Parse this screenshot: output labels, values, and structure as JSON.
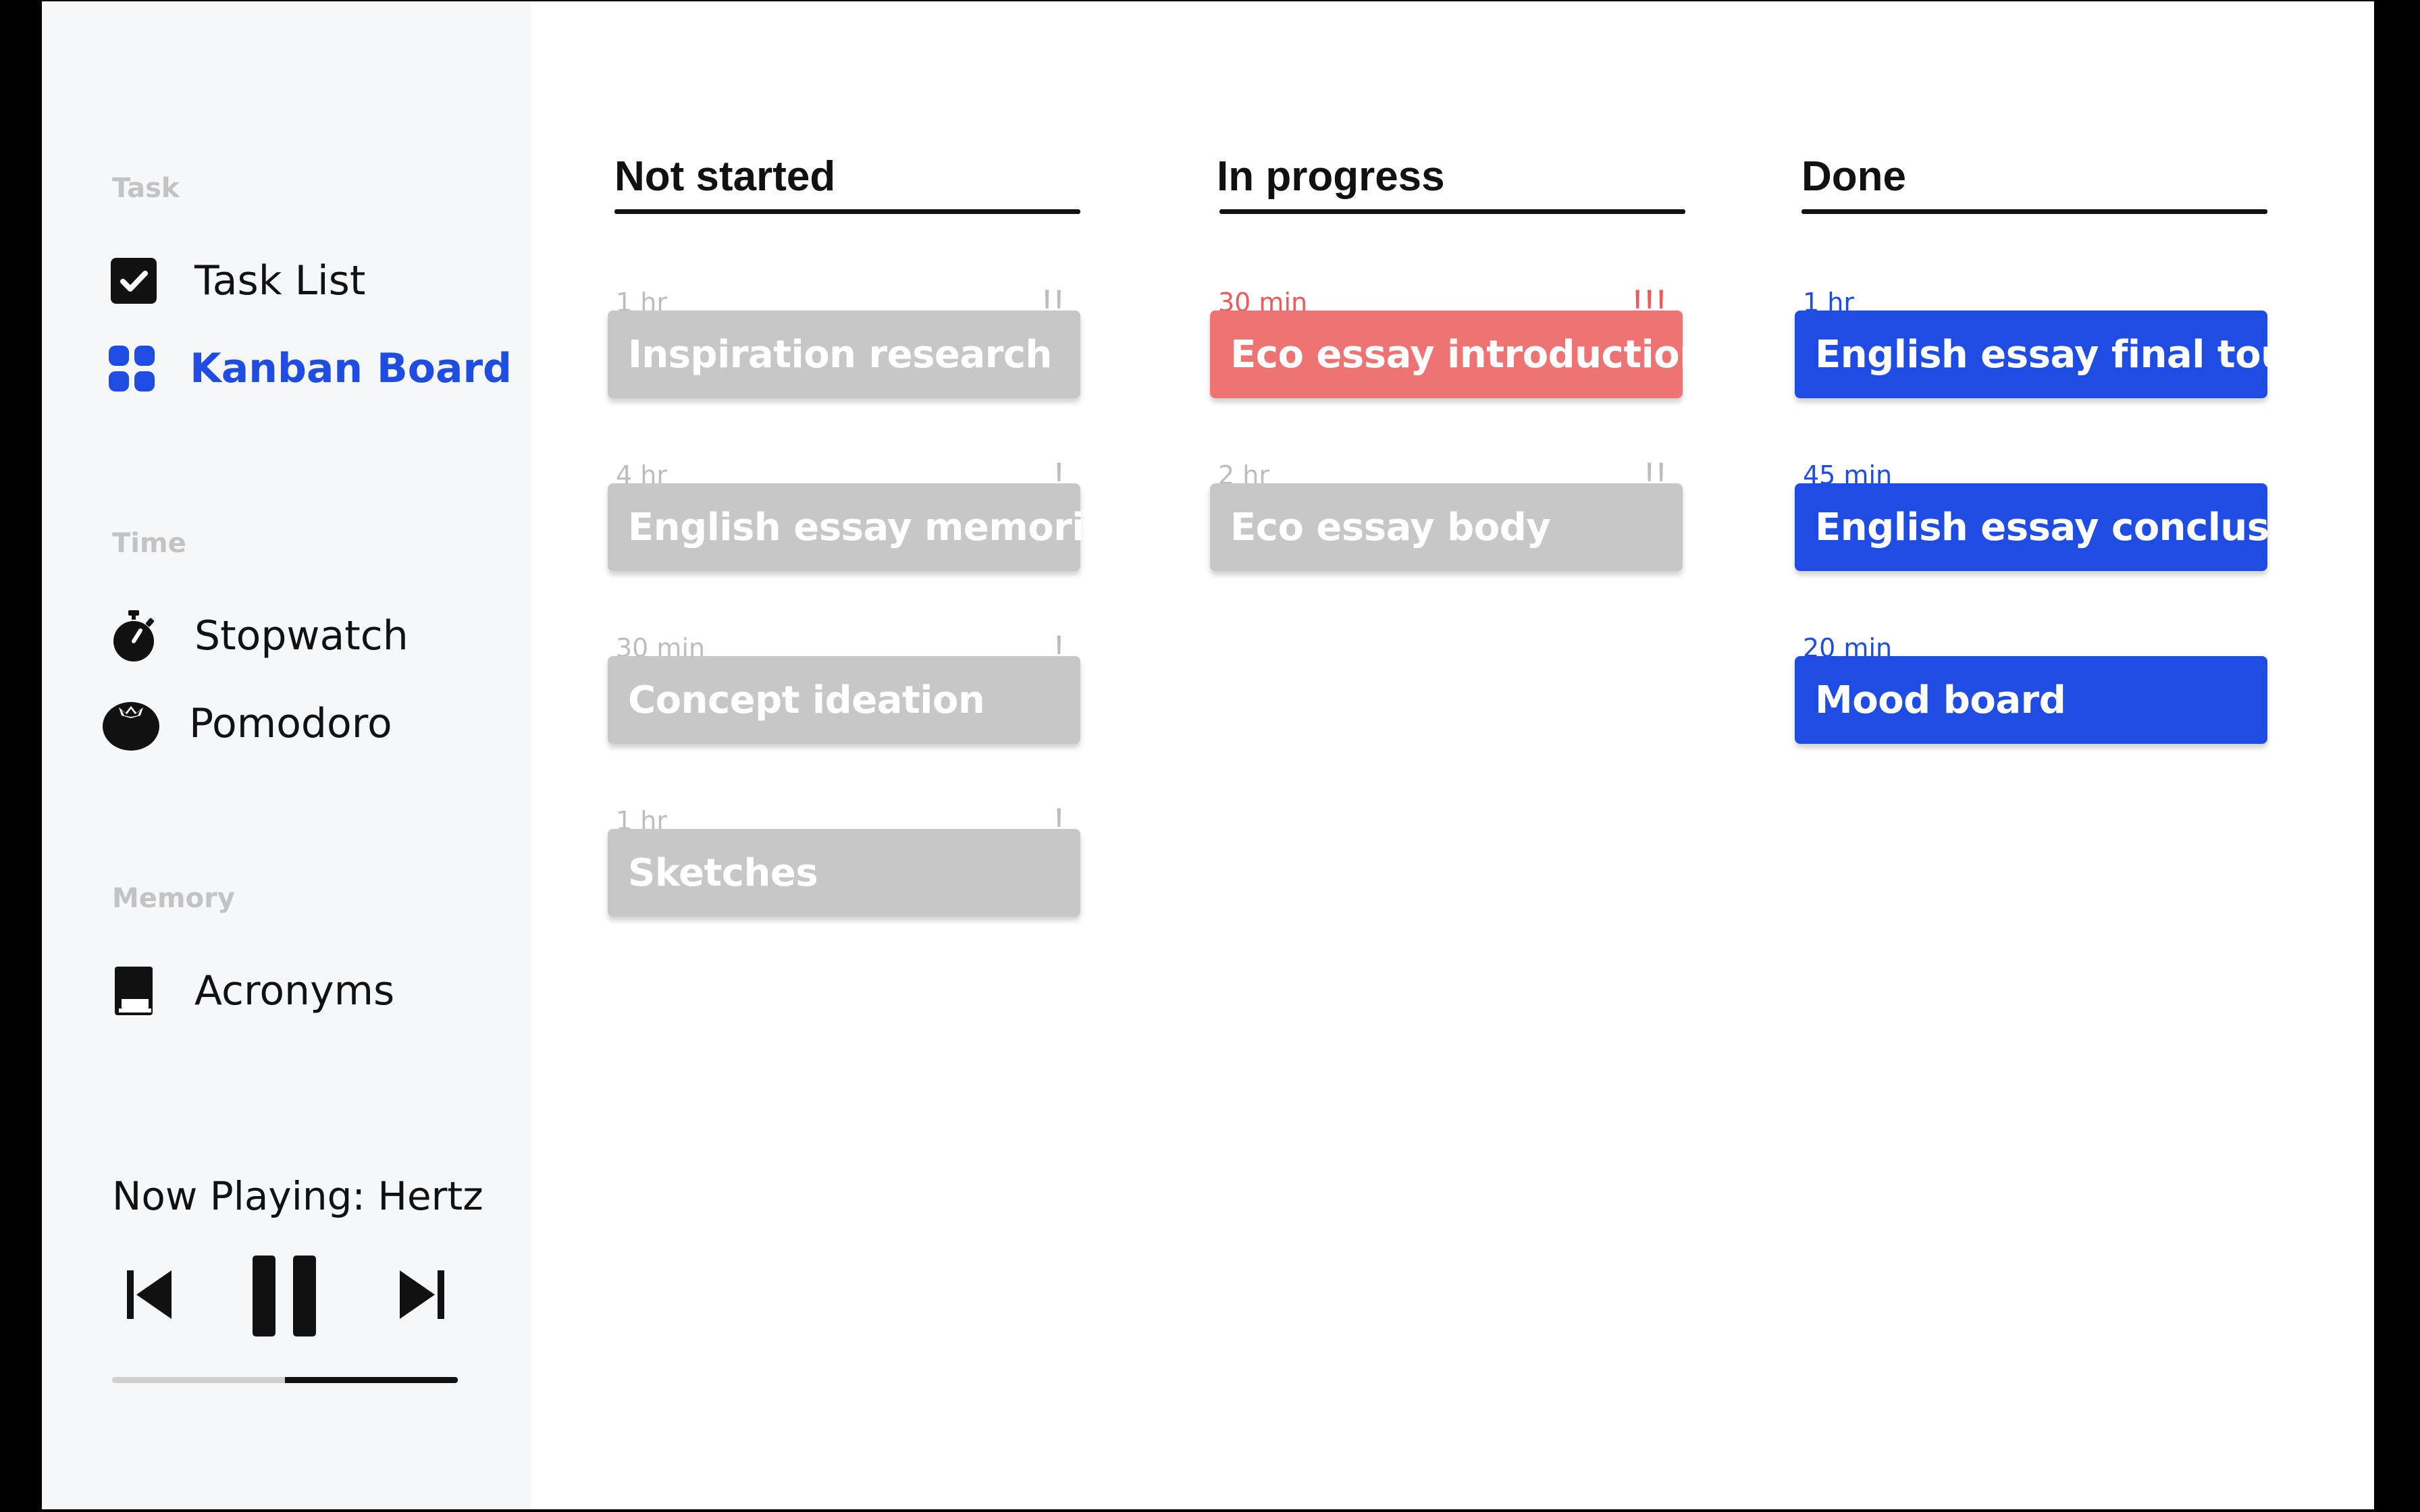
{
  "sidebar": {
    "sections": [
      {
        "title": "Task",
        "items": [
          {
            "label": "Task List",
            "icon": "checkbox-icon",
            "active": false
          },
          {
            "label": "Kanban Board",
            "icon": "grid-icon",
            "active": true
          }
        ]
      },
      {
        "title": "Time",
        "items": [
          {
            "label": "Stopwatch",
            "icon": "stopwatch-icon",
            "active": false
          },
          {
            "label": "Pomodoro",
            "icon": "tomato-icon",
            "active": false
          }
        ]
      },
      {
        "title": "Memory",
        "items": [
          {
            "label": "Acronyms",
            "icon": "book-icon",
            "active": false
          }
        ]
      }
    ]
  },
  "player": {
    "now_playing": "Now Playing: Hertz",
    "progress": 0.5,
    "controls": [
      "previous-icon",
      "pause-icon",
      "next-icon"
    ]
  },
  "board": {
    "columns": [
      {
        "title": "Not started",
        "cards": [
          {
            "time": "1 hr",
            "priority": "!!",
            "label": "Inspiration research"
          },
          {
            "time": "4 hr",
            "priority": "!",
            "label": "English essay memorise"
          },
          {
            "time": "30 min",
            "priority": "!",
            "label": "Concept ideation"
          },
          {
            "time": "1 hr",
            "priority": "!",
            "label": "Sketches"
          }
        ]
      },
      {
        "title": "In progress",
        "cards": [
          {
            "time": "30 min",
            "priority": "!!!",
            "label": "Eco essay introduction",
            "urgent": true
          },
          {
            "time": "2 hr",
            "priority": "!!",
            "label": "Eco essay body"
          }
        ]
      },
      {
        "title": "Done",
        "cards": [
          {
            "time": "1 hr",
            "priority": "",
            "label": "English essay final touch"
          },
          {
            "time": "45 min",
            "priority": "",
            "label": "English essay conclusion"
          },
          {
            "time": "20 min",
            "priority": "",
            "label": "Mood board"
          }
        ]
      }
    ]
  },
  "colors": {
    "accent": "#1f4de4",
    "urgent": "#ee7373",
    "urgent_text": "#ee5a5a",
    "inactive_card": "#c7c7c7",
    "inactive_text": "#bdbdbd",
    "section_title": "#c3c3c3",
    "sidebar_bg": "#f6f7f9"
  }
}
